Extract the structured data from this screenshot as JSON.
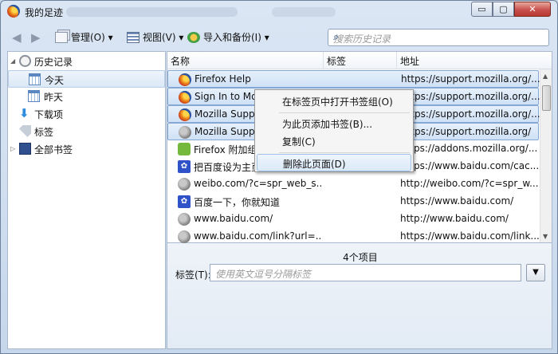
{
  "window": {
    "title": "我的足迹",
    "min_label": "▭",
    "max_label": "▢",
    "close_label": "✕"
  },
  "toolbar": {
    "back": "◀",
    "forward": "▶",
    "manage": "管理(O)",
    "view": "视图(V)",
    "import": "导入和备份(I)",
    "dropdown_marker": "▾",
    "search_placeholder": "搜索历史记录"
  },
  "sidebar": {
    "items": [
      {
        "label": "历史记录",
        "icon": "clock-icon"
      },
      {
        "label": "今天",
        "icon": "calendar-icon"
      },
      {
        "label": "昨天",
        "icon": "calendar-icon"
      },
      {
        "label": "下载项",
        "icon": "download-arrow-icon"
      },
      {
        "label": "标签",
        "icon": "tag-icon"
      },
      {
        "label": "全部书签",
        "icon": "bookmarks-icon"
      }
    ]
  },
  "table": {
    "columns": [
      "名称",
      "标签",
      "地址"
    ],
    "rows": [
      {
        "name": "Firefox Help",
        "url": "https://support.mozilla.org/...",
        "icon": "firefox"
      },
      {
        "name": "Sign In to Mo",
        "url": "https://support.mozilla.org/...",
        "icon": "firefox"
      },
      {
        "name": "Mozilla Supp",
        "url": "https://support.mozilla.org/...",
        "icon": "firefox"
      },
      {
        "name": "Mozilla Supp",
        "url": "https://support.mozilla.org/",
        "icon": "globe"
      },
      {
        "name": "Firefox 附加组",
        "url": "https://addons.mozilla.org/...",
        "icon": "puzzle"
      },
      {
        "name": "把百度设为主页",
        "url": "https://www.baidu.com/cac...",
        "icon": "baidu"
      },
      {
        "name": "weibo.com/?c=spr_web_s...",
        "url": "http://weibo.com/?c=spr_w...",
        "icon": "globe"
      },
      {
        "name": "百度一下，你就知道",
        "url": "https://www.baidu.com/",
        "icon": "baidu"
      },
      {
        "name": "www.baidu.com/",
        "url": "http://www.baidu.com/",
        "icon": "globe"
      },
      {
        "name": "www.baidu.com/link?url=...",
        "url": "https://www.baidu.com/link...",
        "icon": "globe"
      }
    ]
  },
  "details": {
    "count": "4个项目",
    "tag_label": "标签(T):",
    "tag_placeholder": "使用英文逗号分隔标签",
    "dropdown": "▼"
  },
  "context_menu": {
    "items": [
      "在标签页中打开书签组(O)",
      "为此页添加书签(B)...",
      "复制(C)",
      "删除此页面(D)"
    ]
  }
}
